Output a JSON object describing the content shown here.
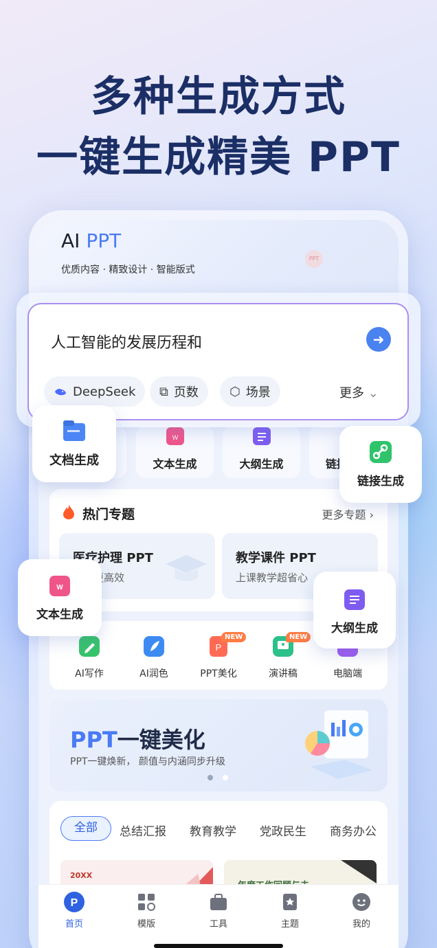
{
  "hero": {
    "line1": "多种生成方式",
    "line2": "一键生成精美 PPT"
  },
  "app": {
    "brand_ai": "AI",
    "brand_ppt": "PPT",
    "slogan": "优质内容 · 精致设计 · 智能版式",
    "deco_logo": "PPT"
  },
  "prompt": {
    "text": "人工智能的发展历程和",
    "chips": [
      "DeepSeek",
      "页数",
      "场景"
    ],
    "more": "更多"
  },
  "gen_modes": [
    "文档生成",
    "文本生成",
    "大纲生成",
    "链接生成"
  ],
  "gen_partial": "链接",
  "hot": {
    "title": "热门专题",
    "more": "更多专题",
    "cards": [
      {
        "title": "医疗护理 PPT",
        "sub": "汇报更高效"
      },
      {
        "title": "教学课件 PPT",
        "sub": "上课教学超省心"
      }
    ]
  },
  "tools": [
    {
      "label": "AI写作",
      "badge": ""
    },
    {
      "label": "AI润色",
      "badge": ""
    },
    {
      "label": "PPT美化",
      "badge": "NEW"
    },
    {
      "label": "演讲稿",
      "badge": "NEW"
    },
    {
      "label": "电脑端",
      "badge": ""
    }
  ],
  "banner": {
    "title_blue": "PPT",
    "title_rest": "一键美化",
    "sub": "PPT一键焕新， 颜值与内涵同步升级"
  },
  "categories": [
    "全部",
    "总结汇报",
    "教育教学",
    "党政民生",
    "商务办公"
  ],
  "thumbs": {
    "left": "20XX",
    "right": "年度工作回顾与未"
  },
  "tabbar": [
    "首页",
    "模版",
    "工具",
    "主题",
    "我的"
  ],
  "colors": {
    "accent": "#4a7bf5",
    "hero_text": "#1b2f66",
    "new_badge": "#ff7d45"
  }
}
